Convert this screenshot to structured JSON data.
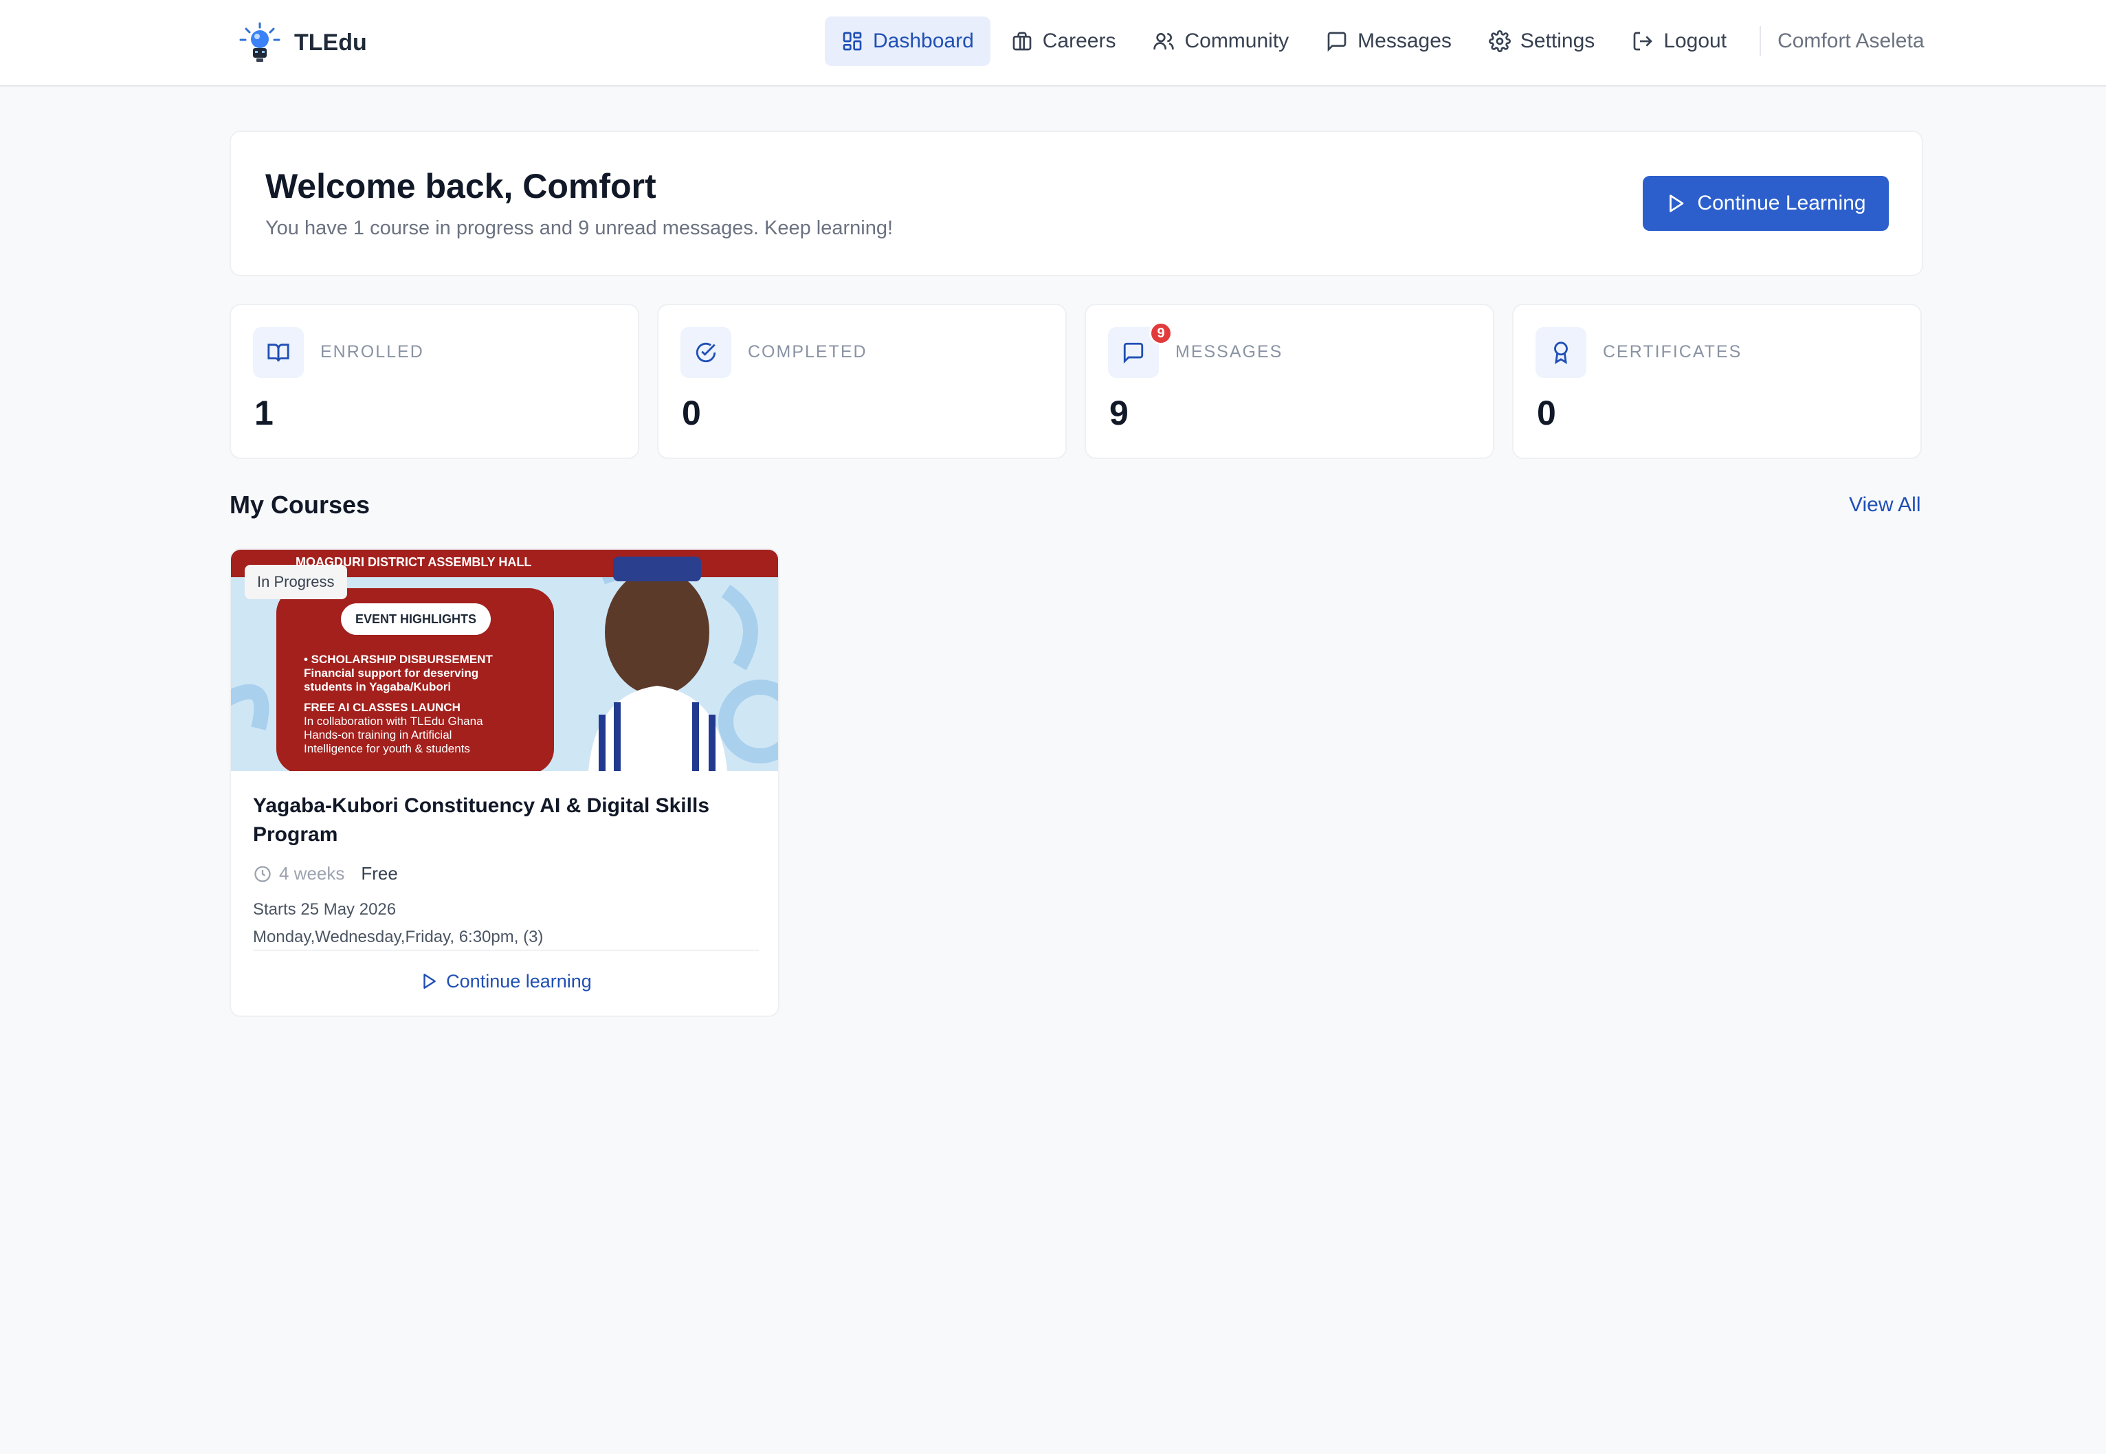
{
  "brand": {
    "name": "TLEdu",
    "logo_icon": "lightbulb-robot-icon"
  },
  "nav": {
    "items": [
      {
        "label": "Dashboard",
        "icon": "grid-icon",
        "active": true
      },
      {
        "label": "Careers",
        "icon": "briefcase-icon",
        "active": false
      },
      {
        "label": "Community",
        "icon": "users-icon",
        "active": false
      },
      {
        "label": "Messages",
        "icon": "chat-icon",
        "active": false
      },
      {
        "label": "Settings",
        "icon": "gear-icon",
        "active": false
      },
      {
        "label": "Logout",
        "icon": "logout-icon",
        "active": false
      }
    ],
    "user_name": "Comfort Aseleta"
  },
  "welcome": {
    "title": "Welcome back, Comfort",
    "subtitle": "You have 1 course in progress and 9 unread messages. Keep learning!",
    "cta_label": "Continue Learning"
  },
  "stats": [
    {
      "label": "ENROLLED",
      "value": "1",
      "icon": "book-icon"
    },
    {
      "label": "COMPLETED",
      "value": "0",
      "icon": "check-circle-icon"
    },
    {
      "label": "MESSAGES",
      "value": "9",
      "icon": "chat-icon",
      "badge": "9"
    },
    {
      "label": "CERTIFICATES",
      "value": "0",
      "icon": "award-icon"
    }
  ],
  "courses_section": {
    "title": "My Courses",
    "view_all_label": "View All"
  },
  "courses": [
    {
      "status": "In Progress",
      "title": "Yagaba-Kubori Constituency AI & Digital Skills Program",
      "duration": "4 weeks",
      "price": "Free",
      "starts": "Starts 25 May 2026",
      "schedule": "Monday,Wednesday,Friday, 6:30pm, (3)",
      "action_label": "Continue learning",
      "image": {
        "venue": "MOAGDURI DISTRICT ASSEMBLY HALL",
        "highlights_label": "EVENT HIGHLIGHTS",
        "lines": [
          "• SCHOLARSHIP DISBURSEMENT",
          "Financial support for deserving",
          "students in Yagaba/Kubori",
          "FREE AI CLASSES LAUNCH",
          "In collaboration with TLEdu Ghana",
          "Hands-on training in Artificial",
          "Intelligence for youth & students"
        ]
      }
    }
  ],
  "colors": {
    "primary": "#2c5fcc",
    "accent_link": "#1f4fb5",
    "badge": "#e23b3b",
    "poster_red": "#a3201d"
  }
}
